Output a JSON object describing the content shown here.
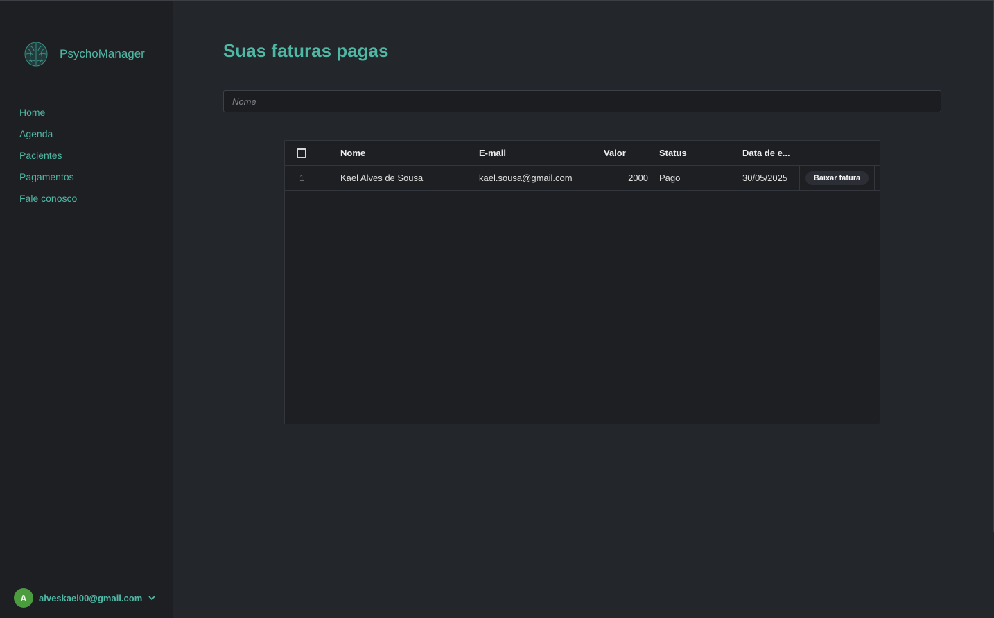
{
  "app": {
    "name": "PsychoManager",
    "brand_icon": "brain-icon"
  },
  "sidebar": {
    "items": [
      {
        "label": "Home"
      },
      {
        "label": "Agenda"
      },
      {
        "label": "Pacientes"
      },
      {
        "label": "Pagamentos"
      },
      {
        "label": "Fale conosco"
      }
    ]
  },
  "user": {
    "avatar_letter": "A",
    "email": "alveskael00@gmail.com",
    "avatar_color": "#4b9b3f"
  },
  "page": {
    "title": "Suas faturas pagas"
  },
  "search": {
    "placeholder": "Nome",
    "value": ""
  },
  "table": {
    "columns": [
      "Nome",
      "E-mail",
      "Valor",
      "Status",
      "Data de e..."
    ],
    "rows": [
      {
        "num": "1",
        "nome": "Kael Alves de Sousa",
        "email": "kael.sousa@gmail.com",
        "valor": "2000",
        "status": "Pago",
        "data": "30/05/2025",
        "action": "Baixar fatura"
      }
    ]
  },
  "colors": {
    "accent": "#4fb8a5",
    "background": "#23262b",
    "sidebar": "#1d1f23"
  }
}
